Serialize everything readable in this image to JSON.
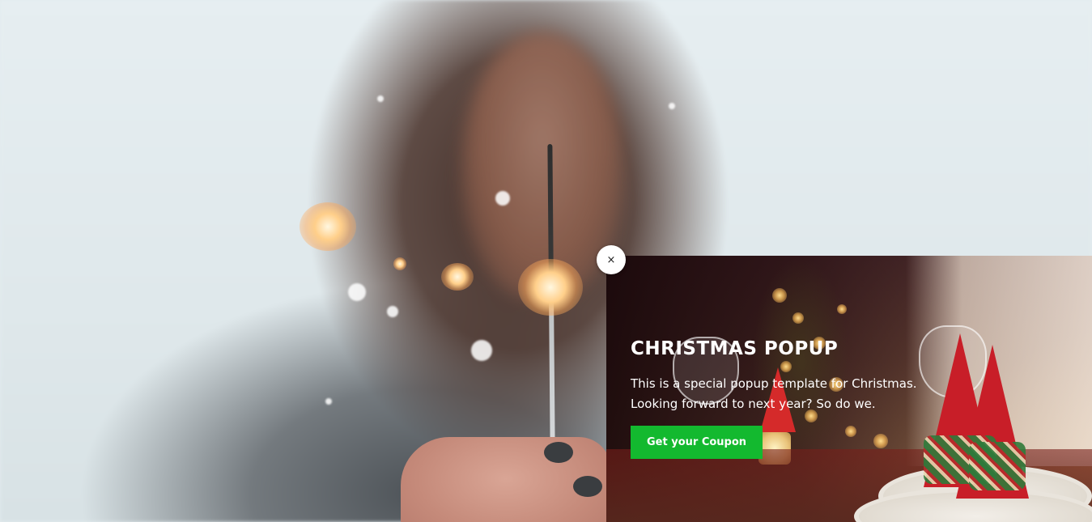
{
  "popup": {
    "title": "CHRISTMAS POPUP",
    "text_line1": "This is a special popup template for Christmas.",
    "text_line2": "Looking forward to next year? So do we.",
    "button_label": "Get your Coupon",
    "button_color": "#13b92f",
    "close_icon": "close-icon",
    "close_label": "×"
  },
  "background": {
    "description_icon": "photo"
  }
}
